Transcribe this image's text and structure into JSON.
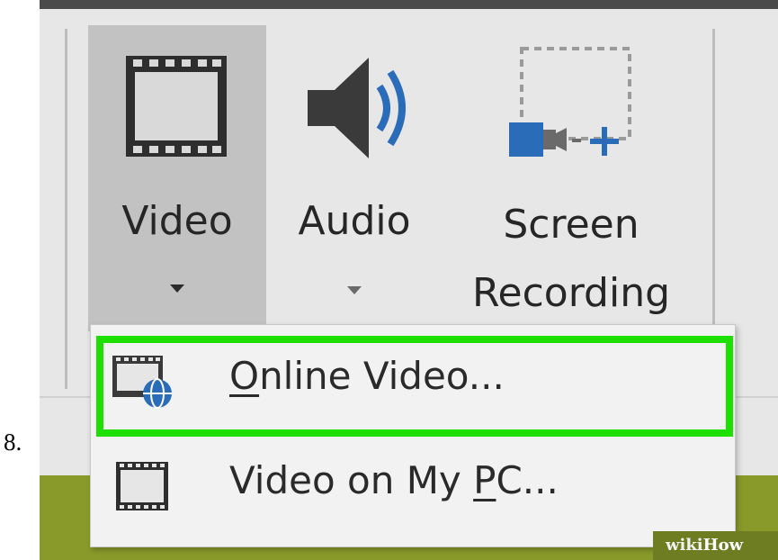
{
  "step_number": "8.",
  "ribbon": {
    "buttons": [
      {
        "id": "video",
        "label": "Video",
        "icon": "film-strip-icon",
        "has_dropdown": true
      },
      {
        "id": "audio",
        "label": "Audio",
        "icon": "speaker-icon",
        "has_dropdown": true
      },
      {
        "id": "screen",
        "label_line1": "Screen",
        "label_line2": "Recording",
        "icon": "screen-recording-icon"
      }
    ]
  },
  "dropdown": {
    "items": [
      {
        "label_first": "O",
        "label_rest": "nline Video...",
        "icon": "online-video-icon",
        "highlighted": true,
        "highlight_color": "#1ee000"
      },
      {
        "label_before": "Video on My ",
        "label_underlined": "P",
        "label_after": "C...",
        "icon": "film-strip-icon"
      }
    ]
  },
  "watermark": {
    "part1": "wiki",
    "part2": "How"
  },
  "colors": {
    "highlight": "#1ee000",
    "accent_blue": "#2b6cb8",
    "ribbon_bg": "#e7e7e7",
    "selected_btn": "#c2c2c2"
  }
}
